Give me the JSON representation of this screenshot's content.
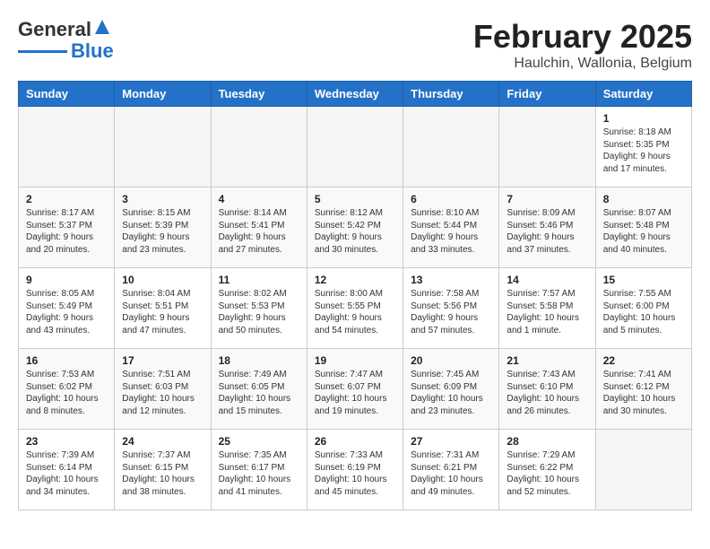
{
  "header": {
    "logo_line1": "General",
    "logo_line2": "Blue",
    "title": "February 2025",
    "subtitle": "Haulchin, Wallonia, Belgium"
  },
  "weekdays": [
    "Sunday",
    "Monday",
    "Tuesday",
    "Wednesday",
    "Thursday",
    "Friday",
    "Saturday"
  ],
  "weeks": [
    [
      {
        "day": "",
        "info": ""
      },
      {
        "day": "",
        "info": ""
      },
      {
        "day": "",
        "info": ""
      },
      {
        "day": "",
        "info": ""
      },
      {
        "day": "",
        "info": ""
      },
      {
        "day": "",
        "info": ""
      },
      {
        "day": "1",
        "info": "Sunrise: 8:18 AM\nSunset: 5:35 PM\nDaylight: 9 hours and 17 minutes."
      }
    ],
    [
      {
        "day": "2",
        "info": "Sunrise: 8:17 AM\nSunset: 5:37 PM\nDaylight: 9 hours and 20 minutes."
      },
      {
        "day": "3",
        "info": "Sunrise: 8:15 AM\nSunset: 5:39 PM\nDaylight: 9 hours and 23 minutes."
      },
      {
        "day": "4",
        "info": "Sunrise: 8:14 AM\nSunset: 5:41 PM\nDaylight: 9 hours and 27 minutes."
      },
      {
        "day": "5",
        "info": "Sunrise: 8:12 AM\nSunset: 5:42 PM\nDaylight: 9 hours and 30 minutes."
      },
      {
        "day": "6",
        "info": "Sunrise: 8:10 AM\nSunset: 5:44 PM\nDaylight: 9 hours and 33 minutes."
      },
      {
        "day": "7",
        "info": "Sunrise: 8:09 AM\nSunset: 5:46 PM\nDaylight: 9 hours and 37 minutes."
      },
      {
        "day": "8",
        "info": "Sunrise: 8:07 AM\nSunset: 5:48 PM\nDaylight: 9 hours and 40 minutes."
      }
    ],
    [
      {
        "day": "9",
        "info": "Sunrise: 8:05 AM\nSunset: 5:49 PM\nDaylight: 9 hours and 43 minutes."
      },
      {
        "day": "10",
        "info": "Sunrise: 8:04 AM\nSunset: 5:51 PM\nDaylight: 9 hours and 47 minutes."
      },
      {
        "day": "11",
        "info": "Sunrise: 8:02 AM\nSunset: 5:53 PM\nDaylight: 9 hours and 50 minutes."
      },
      {
        "day": "12",
        "info": "Sunrise: 8:00 AM\nSunset: 5:55 PM\nDaylight: 9 hours and 54 minutes."
      },
      {
        "day": "13",
        "info": "Sunrise: 7:58 AM\nSunset: 5:56 PM\nDaylight: 9 hours and 57 minutes."
      },
      {
        "day": "14",
        "info": "Sunrise: 7:57 AM\nSunset: 5:58 PM\nDaylight: 10 hours and 1 minute."
      },
      {
        "day": "15",
        "info": "Sunrise: 7:55 AM\nSunset: 6:00 PM\nDaylight: 10 hours and 5 minutes."
      }
    ],
    [
      {
        "day": "16",
        "info": "Sunrise: 7:53 AM\nSunset: 6:02 PM\nDaylight: 10 hours and 8 minutes."
      },
      {
        "day": "17",
        "info": "Sunrise: 7:51 AM\nSunset: 6:03 PM\nDaylight: 10 hours and 12 minutes."
      },
      {
        "day": "18",
        "info": "Sunrise: 7:49 AM\nSunset: 6:05 PM\nDaylight: 10 hours and 15 minutes."
      },
      {
        "day": "19",
        "info": "Sunrise: 7:47 AM\nSunset: 6:07 PM\nDaylight: 10 hours and 19 minutes."
      },
      {
        "day": "20",
        "info": "Sunrise: 7:45 AM\nSunset: 6:09 PM\nDaylight: 10 hours and 23 minutes."
      },
      {
        "day": "21",
        "info": "Sunrise: 7:43 AM\nSunset: 6:10 PM\nDaylight: 10 hours and 26 minutes."
      },
      {
        "day": "22",
        "info": "Sunrise: 7:41 AM\nSunset: 6:12 PM\nDaylight: 10 hours and 30 minutes."
      }
    ],
    [
      {
        "day": "23",
        "info": "Sunrise: 7:39 AM\nSunset: 6:14 PM\nDaylight: 10 hours and 34 minutes."
      },
      {
        "day": "24",
        "info": "Sunrise: 7:37 AM\nSunset: 6:15 PM\nDaylight: 10 hours and 38 minutes."
      },
      {
        "day": "25",
        "info": "Sunrise: 7:35 AM\nSunset: 6:17 PM\nDaylight: 10 hours and 41 minutes."
      },
      {
        "day": "26",
        "info": "Sunrise: 7:33 AM\nSunset: 6:19 PM\nDaylight: 10 hours and 45 minutes."
      },
      {
        "day": "27",
        "info": "Sunrise: 7:31 AM\nSunset: 6:21 PM\nDaylight: 10 hours and 49 minutes."
      },
      {
        "day": "28",
        "info": "Sunrise: 7:29 AM\nSunset: 6:22 PM\nDaylight: 10 hours and 52 minutes."
      },
      {
        "day": "",
        "info": ""
      }
    ]
  ]
}
